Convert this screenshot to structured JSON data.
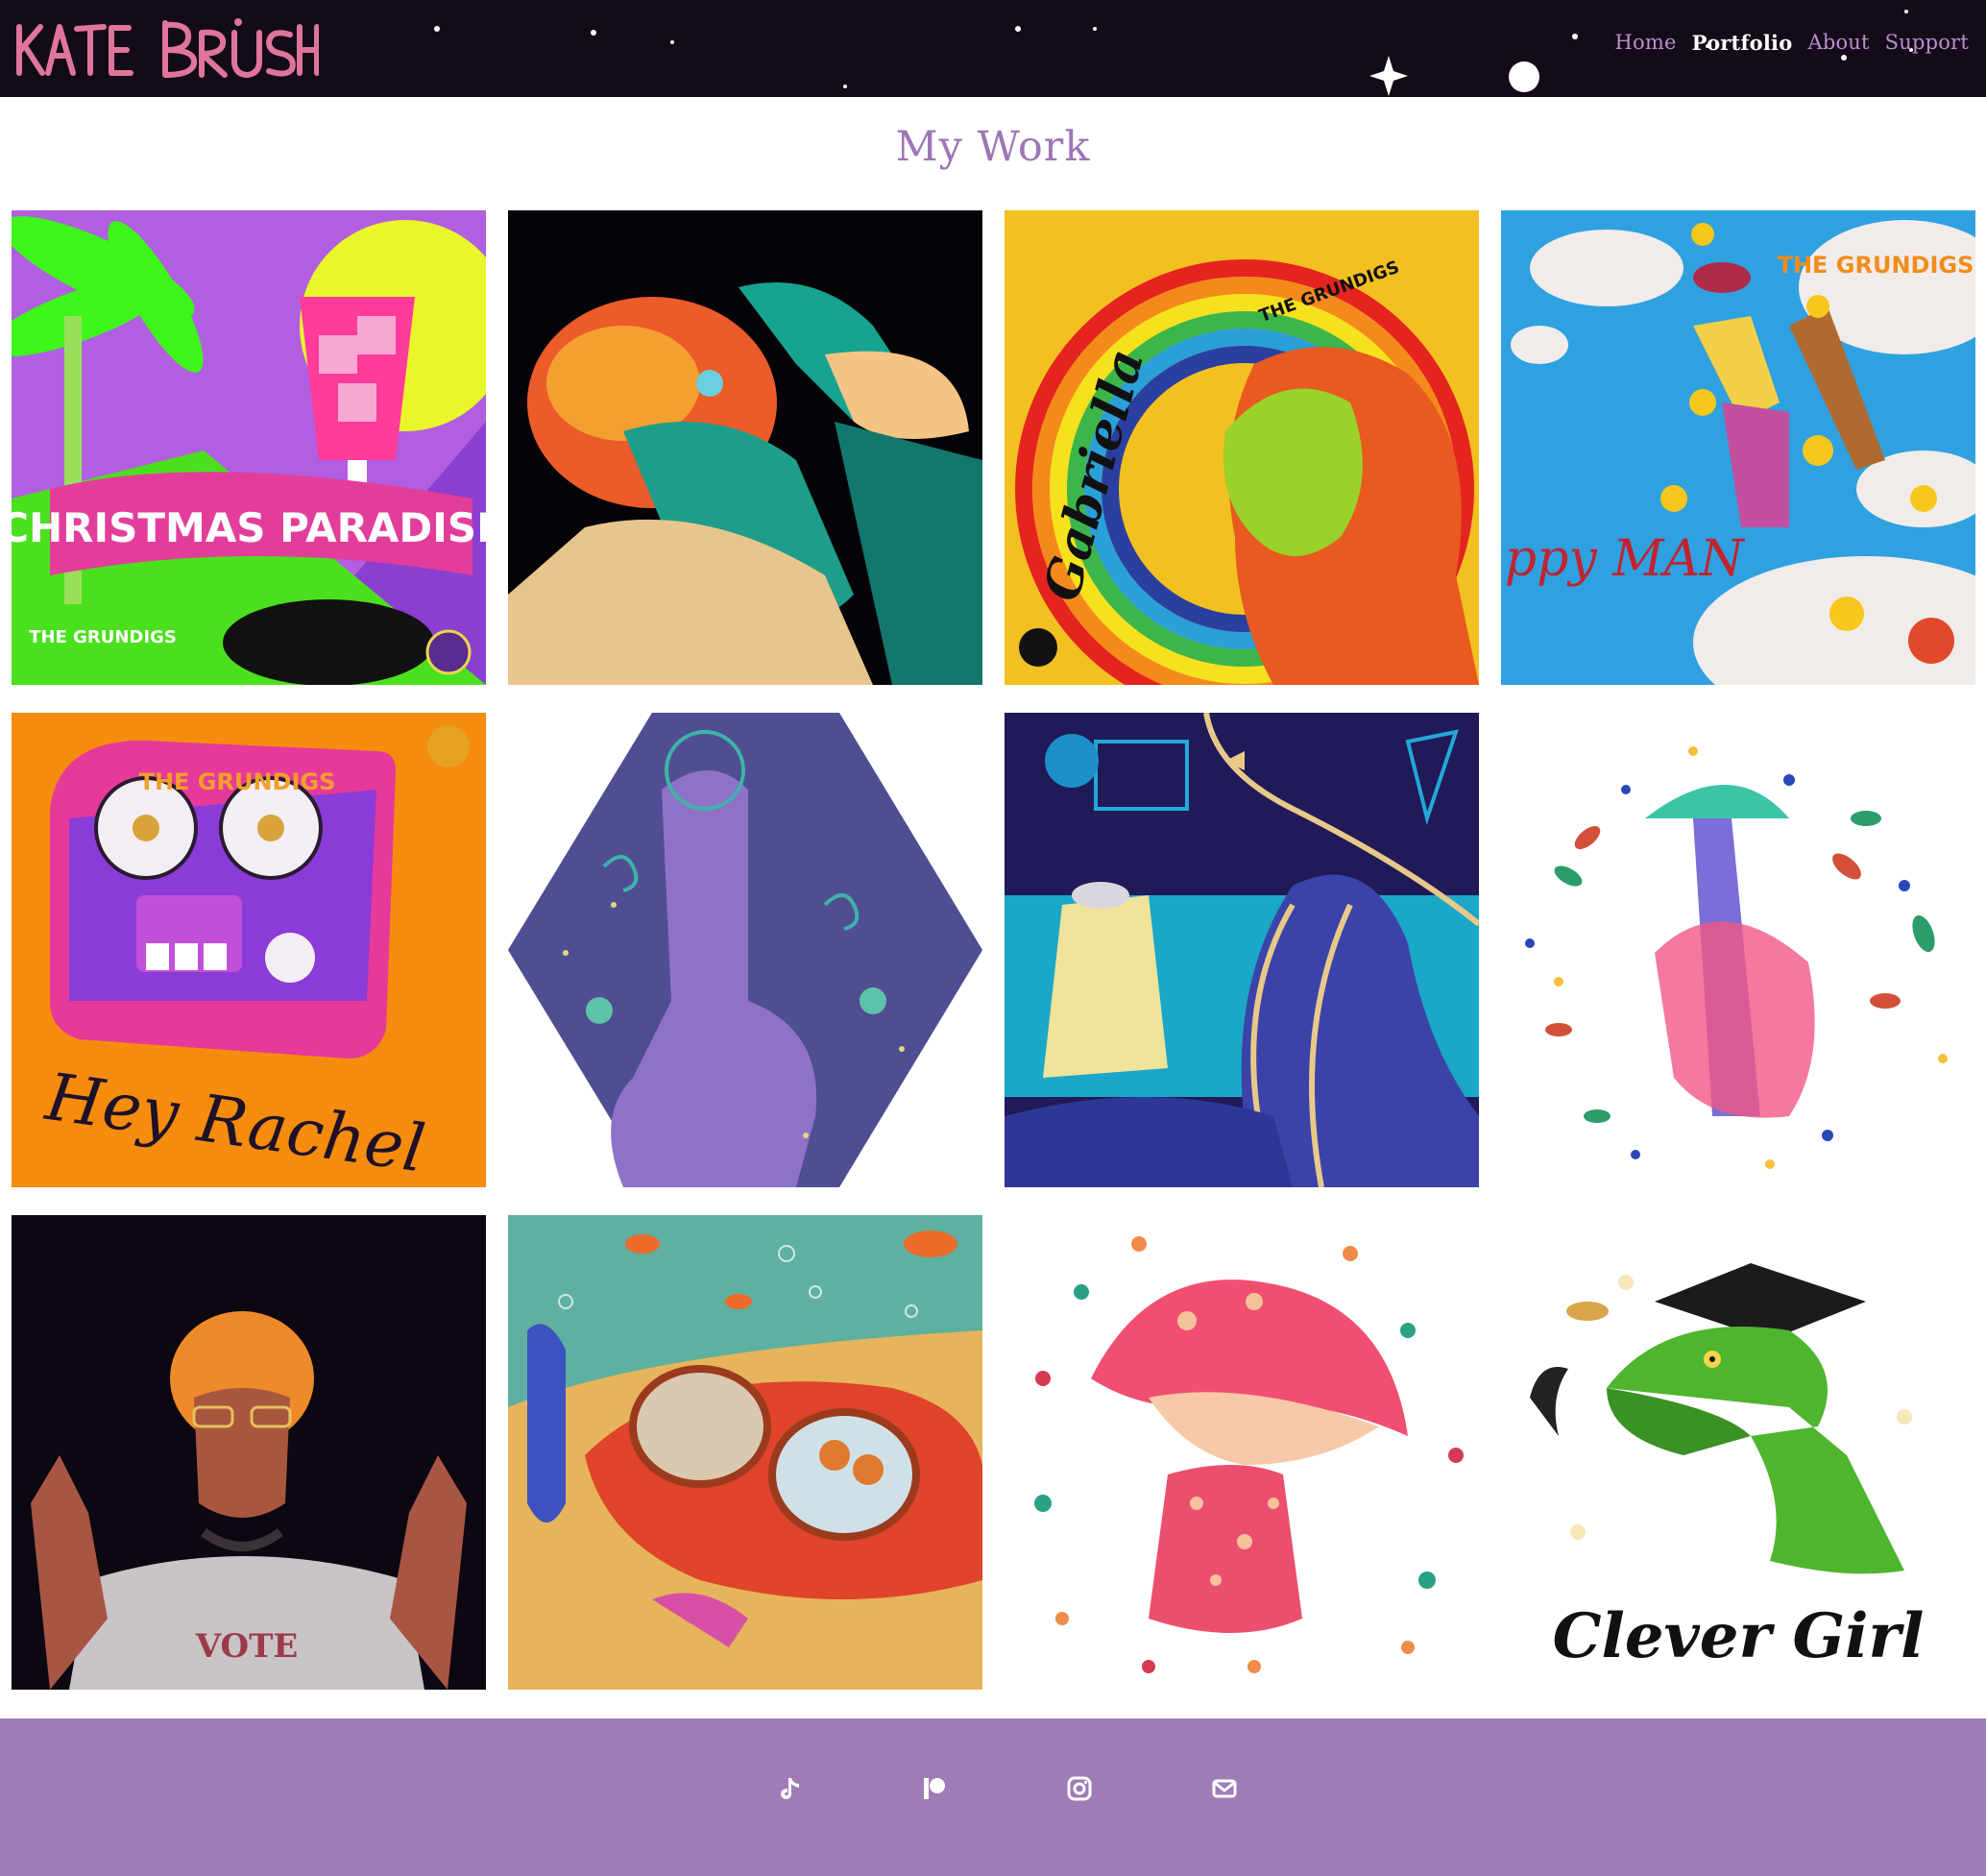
{
  "header": {
    "logo_text": "KATE BRUSH",
    "nav": [
      {
        "label": "Home",
        "active": false
      },
      {
        "label": "Portfolio",
        "active": true
      },
      {
        "label": "About",
        "active": false
      },
      {
        "label": "Support",
        "active": false
      }
    ]
  },
  "main": {
    "title": "My Work",
    "artworks": [
      {
        "text": "CHRISTMAS PARADISE",
        "subtext": "THE GRUNDIGS"
      },
      {
        "text": ""
      },
      {
        "text": "Gabriella",
        "subtext": "THE GRUNDIGS"
      },
      {
        "text": "Happy MAN",
        "subtext": "THE GRUNDIGS"
      },
      {
        "text": "Hey Rachel",
        "subtext": "THE GRUNDIGS"
      },
      {
        "text": ""
      },
      {
        "text": ""
      },
      {
        "text": ""
      },
      {
        "text": "VOTE"
      },
      {
        "text": ""
      },
      {
        "text": ""
      },
      {
        "text": "Clever Girl"
      }
    ]
  },
  "footer": {
    "social": [
      {
        "icon": "tiktok-icon"
      },
      {
        "icon": "patreon-icon"
      },
      {
        "icon": "instagram-icon"
      },
      {
        "icon": "email-icon"
      }
    ]
  },
  "colors": {
    "header_bg": "#140b18",
    "accent": "#9d76b5",
    "footer_bg": "#a07cb6",
    "logo_pink": "#e0759c"
  }
}
